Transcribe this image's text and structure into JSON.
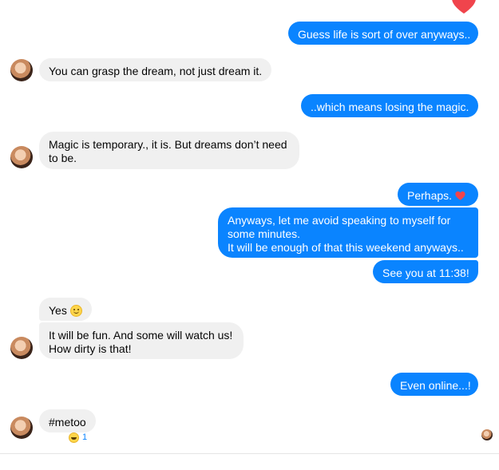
{
  "messages": [
    {
      "side": "out",
      "text": "Guess life is sort of over anyways.."
    },
    {
      "side": "in",
      "text": "You can grasp the dream, not just dream it."
    },
    {
      "side": "out",
      "text": "..which means losing the magic."
    },
    {
      "side": "in",
      "lines": [
        "Magic is temporary., it is. But dreams don’t need",
        "to be."
      ]
    },
    {
      "side": "out",
      "text": "Perhaps."
    },
    {
      "side": "out",
      "lines": [
        "Anyways, let me avoid speaking to myself for",
        "some minutes.",
        "It will be enough of that this weekend anyways.."
      ]
    },
    {
      "side": "out",
      "text": "See you at 11:38!"
    },
    {
      "side": "in",
      "text": "Yes"
    },
    {
      "side": "in",
      "lines": [
        "It will be fun. And some will watch us!",
        "How dirty is that!"
      ]
    },
    {
      "side": "out",
      "text": "Even online...!"
    },
    {
      "side": "in",
      "text": "#metoo"
    }
  ],
  "reaction": {
    "count": "1"
  },
  "colors": {
    "outgoing": "#0a84ff",
    "incoming": "#f0f0f0",
    "heart": "#f0444c"
  },
  "icons": {
    "heart": "red-heart-icon",
    "smile": "slightly-smiling-face-icon",
    "reaction": "grinning-face-icon"
  }
}
